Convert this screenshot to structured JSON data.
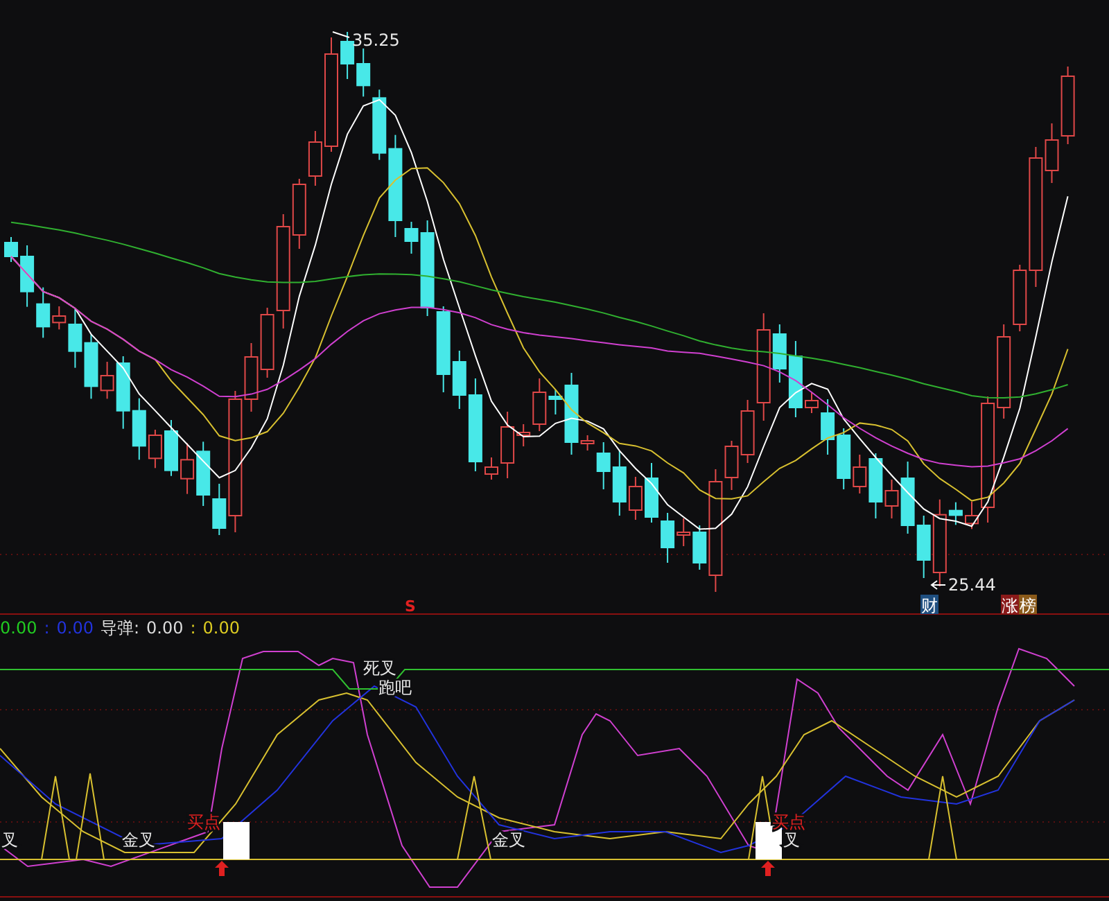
{
  "price_chart": {
    "high_label": "35.25",
    "low_label": "25.44",
    "signal_marker": "S",
    "badges": [
      {
        "text": "财",
        "color": "#1f4f80"
      },
      {
        "text": "涨",
        "color": "#8a1a1a"
      },
      {
        "text": "榜",
        "color": "#8a5a1a"
      }
    ]
  },
  "indicator_legend": [
    {
      "text": "0.00",
      "color": "#22cc22"
    },
    {
      "text": ":",
      "color": "#2233dd"
    },
    {
      "text": "0.00",
      "color": "#2233dd"
    },
    {
      "text": "导弹:",
      "color": "#dddddd"
    },
    {
      "text": "0.00",
      "color": "#dddddd"
    },
    {
      "text": ":",
      "color": "#ddcc22"
    },
    {
      "text": "0.00",
      "color": "#ddcc22"
    }
  ],
  "indicator_signals": [
    {
      "text": "叉",
      "kind": "cross"
    },
    {
      "text": "金叉",
      "kind": "cross"
    },
    {
      "text": "买点",
      "kind": "buy"
    },
    {
      "text": "死叉",
      "kind": "cross"
    },
    {
      "text": "跑吧",
      "kind": "cross"
    },
    {
      "text": "金叉",
      "kind": "cross"
    },
    {
      "text": "买点",
      "kind": "buy"
    },
    {
      "text": "叉",
      "kind": "cross"
    }
  ]
}
